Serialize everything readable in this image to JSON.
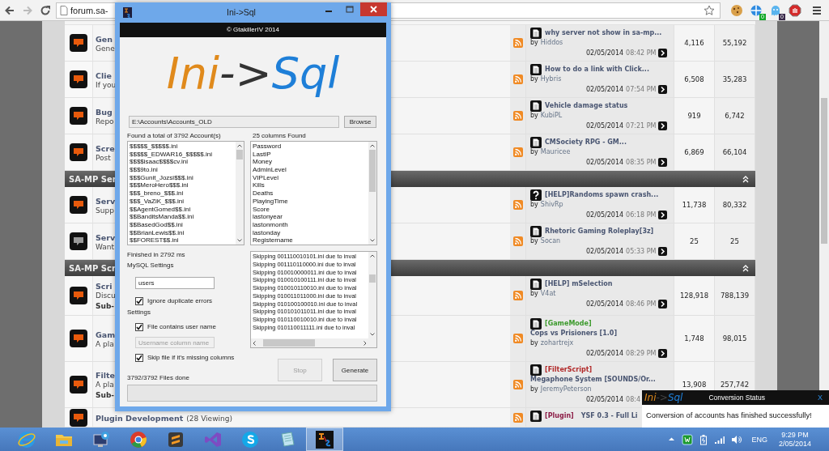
{
  "browser": {
    "url": "forum.sa-",
    "extensions": [
      {
        "kind": "cookie"
      },
      {
        "kind": "globe",
        "badge": "0"
      },
      {
        "kind": "ghost",
        "badge": "0"
      },
      {
        "kind": "stop"
      }
    ]
  },
  "forum": {
    "sections": [
      {
        "rows": [
          {
            "unread": true,
            "title": "Gen",
            "description": "Gene",
            "last_post": {
              "kind": "document",
              "title": "why server not show in sa-mp...",
              "by": "by",
              "author": "Hiddos",
              "date": "02/05/2014",
              "time": "08:42 PM",
              "arrow": true
            },
            "threads": "4,116",
            "posts": "55,192"
          },
          {
            "unread": true,
            "title": "Clie",
            "description": "If you",
            "last_post": {
              "kind": "document",
              "title": "How to do a link with Click...",
              "by": "by",
              "author": "Hybris",
              "date": "02/05/2014",
              "time": "07:54 PM",
              "arrow": true
            },
            "threads": "6,508",
            "posts": "35,283"
          },
          {
            "unread": true,
            "title": "Bug",
            "description": "Repo",
            "last_post": {
              "kind": "document",
              "title": "Vehicle damage status",
              "by": "by",
              "author": "KubiPL",
              "date": "02/05/2014",
              "time": "07:21 PM",
              "arrow": true
            },
            "threads": "919",
            "posts": "6,742"
          },
          {
            "unread": true,
            "title": "Scre",
            "description": "Post",
            "last_post": {
              "kind": "document",
              "title": "CMSociety RPG - GM...",
              "by": "by",
              "author": "Mauricee",
              "date": "02/05/2014",
              "time": "08:35 PM",
              "arrow": true
            },
            "threads": "6,869",
            "posts": "66,104"
          }
        ]
      },
      {
        "header": "SA-MP Ser",
        "rows": [
          {
            "unread": true,
            "title": "Serv",
            "description": "Supp",
            "last_post": {
              "kind": "question",
              "title": "[HELP]Randoms spawn crash...",
              "by": "by",
              "author": "ShivRp",
              "date": "02/05/2014",
              "time": "06:18 PM",
              "arrow": true
            },
            "threads": "11,738",
            "posts": "80,332"
          },
          {
            "unread": false,
            "title": "Serv",
            "description": "Want",
            "last_post": {
              "kind": "document",
              "title": "Rhetoric Gaming Roleplay[3z]",
              "by": "by",
              "author": "Socan",
              "date": "02/05/2014",
              "time": "05:33 PM",
              "arrow": true
            },
            "threads": "25",
            "posts": "25"
          }
        ]
      },
      {
        "header": "SA-MP Scr",
        "rows": [
          {
            "unread": true,
            "title": "Scri",
            "description": "Discu",
            "sub": "Sub-",
            "last_post": {
              "kind": "document",
              "title": "[HELP] mSelection",
              "by": "by",
              "author": "V4at",
              "date": "02/05/2014",
              "time": "08:46 PM",
              "arrow": true
            },
            "threads": "128,918",
            "posts": "788,139"
          },
          {
            "unread": true,
            "title": "Gam",
            "description": "A pla",
            "last_post": {
              "kind": "document",
              "prefix": {
                "text": "[GameMode]",
                "color": "#3c9a2c",
                "inline": false
              },
              "title": "Cops vs Prisioners [1.0]",
              "by": "by",
              "author": "zohartrejx",
              "date": "02/05/2014",
              "time": "08:29 PM",
              "arrow": true
            },
            "threads": "1,748",
            "posts": "98,015"
          },
          {
            "unread": true,
            "title": "Filte",
            "description": "A pla",
            "sub": "Sub-",
            "last_post": {
              "kind": "document",
              "prefix": {
                "text": "[FilterScript]",
                "color": "#b22a2a",
                "inline": false
              },
              "title": "Megaphone System [SOUNDS/Or...",
              "by": "by",
              "author": "JeremyPeterson",
              "date": "02/05/2014",
              "time": "08:4",
              "arrow": false
            },
            "threads": "13,908",
            "posts": "257,742"
          },
          {
            "unread": true,
            "title": "Plugin Development",
            "viewing": "(28 Viewing)",
            "last_post": {
              "kind": "document",
              "prefix": {
                "text": "[Plugin]",
                "color": "#8c1c46",
                "inline": true
              },
              "title": "YSF 0.3 - Full Li"
            }
          }
        ]
      }
    ]
  },
  "dialog": {
    "title": "Ini->Sql",
    "credit": "© GtakillerIV 2014",
    "logo": {
      "left": "Ini",
      "arrow": "->",
      "right": "Sql"
    },
    "path": "E:\\Accounts\\Accounts_OLD",
    "browse": "Browse",
    "accounts_label": "Found a total of 3792 Account(s)",
    "columns_label": "25 columns Found",
    "accounts": [
      "$$$$$_$$$$$.ini",
      "$$$$$_EDWAR16_$$$$$.ini",
      "$$$$isaac$$$$cv.ini",
      "$$$9to.ini",
      "$$$Gunit_Jozsi$$$.ini",
      "$$$MeroHero$$$.ini",
      "$$$_breno_$$$.ini",
      "$$$_VaZiK_$$$.ini",
      "$$AgentGomed$$.ini",
      "$$BanditsManda$$.ini",
      "$$BasedGod$$.ini",
      "$$BrianLewis$$.ini",
      "$$FOREST$$.ini"
    ],
    "columns": [
      "Password",
      "LastIP",
      "Money",
      "AdminLevel",
      "VIPLevel",
      "Kills",
      "Deaths",
      "PlayingTime",
      "Score",
      "lastonyear",
      "lastonmonth",
      "lastonday",
      "Registername"
    ],
    "status": "Finished in 2792 ms",
    "mysql": {
      "label": "MySQL Settings",
      "table_name": "users",
      "options": [
        {
          "label": "Ignore duplicate errors",
          "checked": true
        }
      ]
    },
    "settings": {
      "label": "Settings",
      "items": [
        {
          "kind": "checkbox",
          "label": "File contains user name",
          "checked": true
        },
        {
          "kind": "field",
          "placeholder": "Username column name",
          "disabled": true
        },
        {
          "kind": "checkbox",
          "label": "Skip file if it's missing columns",
          "checked": true
        }
      ]
    },
    "log": [
      "Skipping 001110010101.ini due to inval",
      "Skipping 001110110000.ini due to inval",
      "Skipping 010010000011.ini due to inval",
      "Skipping 010010100111.ini due to inval",
      "Skipping 010010110010.ini due to inval",
      "Skipping 010011011000.ini due to inval",
      "Skipping 010100100010.ini due to inval",
      "Skipping 010101011011.ini due to inval",
      "Skipping 010110010010.ini due to inval",
      "Skipping 010110011111.ini due to inval"
    ],
    "buttons": [
      {
        "label": "Stop",
        "disabled": true
      },
      {
        "label": "Generate",
        "disabled": false
      }
    ],
    "progress_label": "3792/3792 Files done",
    "progress": {
      "level": 0
    }
  },
  "notification": {
    "logo": {
      "left": "Ini",
      "arrow": "->",
      "right": "Sql"
    },
    "title": "Conversion Status",
    "close": "X",
    "message": "Conversion of accounts has finished successfully!"
  },
  "taskbar": {
    "apps": [
      {
        "kind": "ie",
        "active": false
      },
      {
        "kind": "explorer",
        "active": false
      },
      {
        "kind": "remote",
        "active": false
      },
      {
        "kind": "chrome",
        "active": false
      },
      {
        "kind": "sublime",
        "active": false
      },
      {
        "kind": "studio",
        "active": false
      },
      {
        "kind": "skype",
        "active": false
      },
      {
        "kind": "notepad",
        "active": false
      },
      {
        "kind": "inisql",
        "active": true
      }
    ],
    "tray": {
      "language": "ENG",
      "time": "9:29 PM",
      "date": "2/05/2014"
    }
  }
}
